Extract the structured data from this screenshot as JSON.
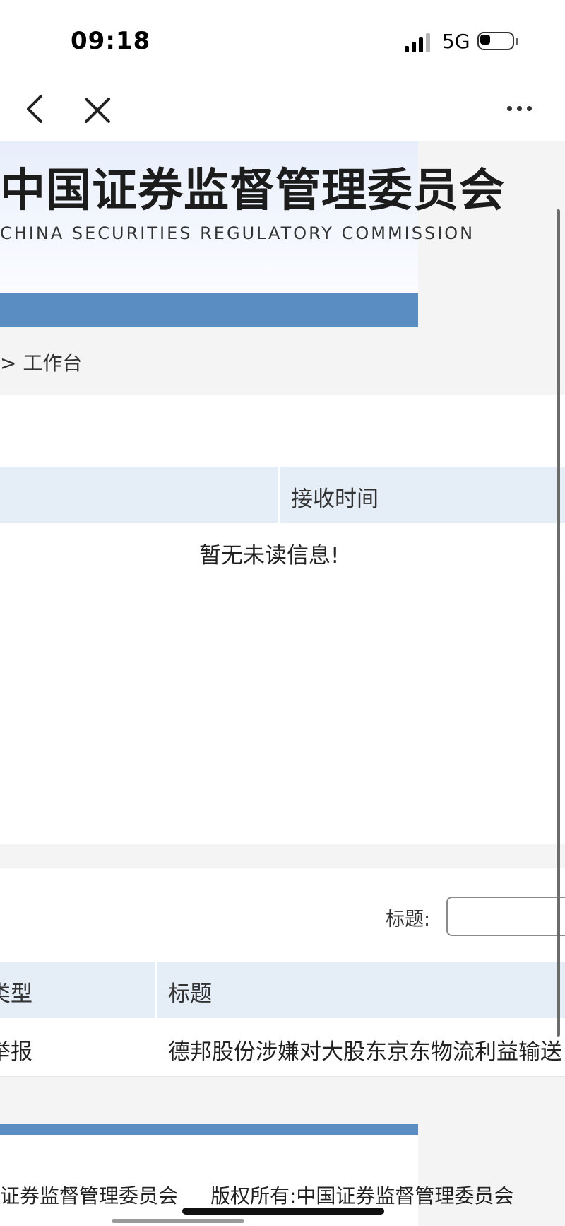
{
  "status_bar": {
    "time": "09:18",
    "network": "5G",
    "icons": [
      "signal-icon",
      "battery-icon"
    ]
  },
  "nav": {
    "icons": [
      "back-icon",
      "close-icon",
      "more-icon"
    ]
  },
  "header": {
    "title_cn": "中国证券监督管理委员会",
    "title_en": "CHINA SECURITIES REGULATORY COMMISSION",
    "brand_color": "#5a8dc1"
  },
  "breadcrumb": {
    "text": "> 工作台"
  },
  "unread_table": {
    "columns": [
      "接收时间"
    ],
    "empty_message": "暂无未读信息!"
  },
  "records": {
    "filter_label": "标题:",
    "filter_value": "",
    "columns": [
      "类型",
      "标题"
    ],
    "rows": [
      {
        "type": "举报",
        "title": "德邦股份涉嫌对大股东京东物流利益输送"
      }
    ]
  },
  "footer": {
    "left": "证券监督管理委员会",
    "right": "版权所有:中国证券监督管理委员会"
  },
  "colors": {
    "table_header_bg": "#e5edf7",
    "page_bg": "#f4f4f4"
  }
}
